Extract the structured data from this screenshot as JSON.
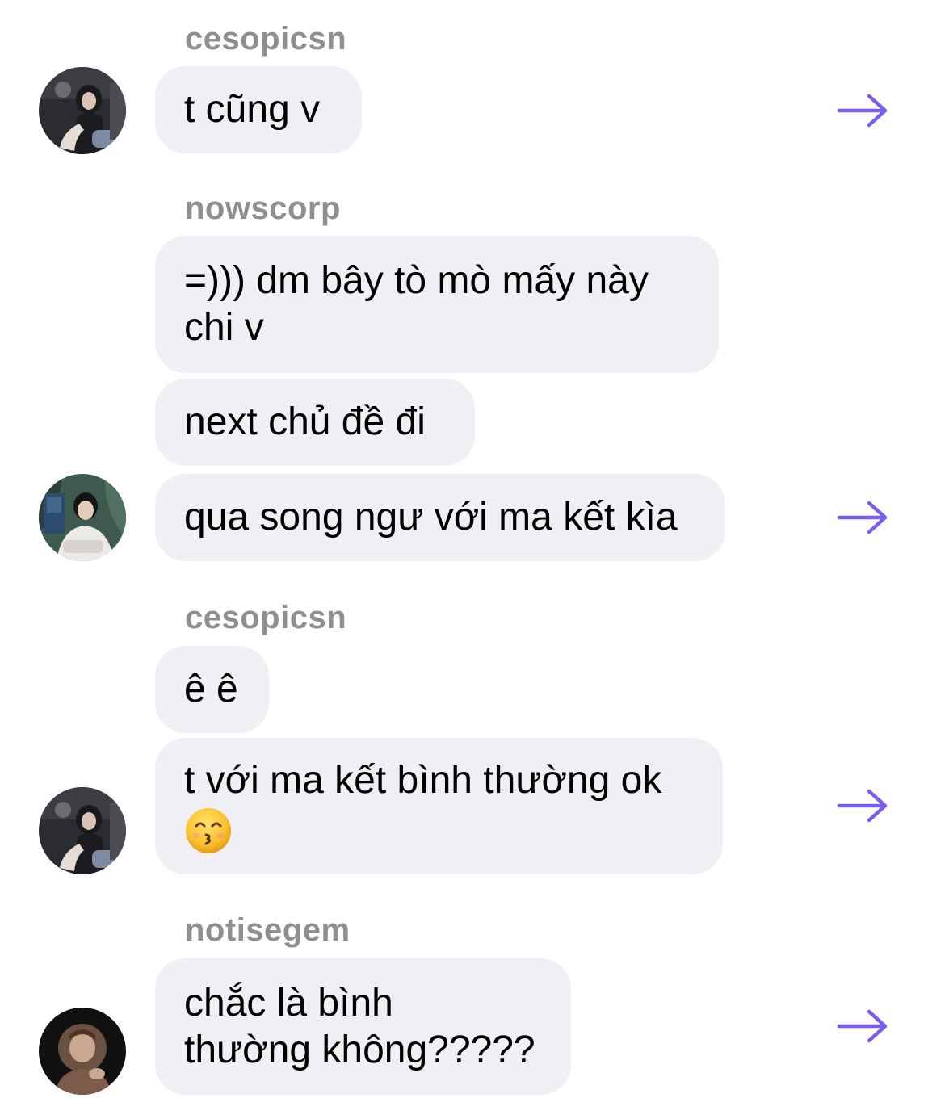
{
  "messages": [
    {
      "username": "cesopicsn",
      "bubbles": [
        [
          "t cũng v"
        ]
      ]
    },
    {
      "username": "nowscorp",
      "bubbles": [
        [
          "=))) dm bây tò mò mấy này",
          "chi v"
        ],
        [
          "next chủ đề đi"
        ],
        [
          "qua song ngư với ma kết kìa"
        ]
      ]
    },
    {
      "username": "cesopicsn",
      "bubbles": [
        [
          "ê ê"
        ],
        [
          "t với ma kết bình thường ok"
        ]
      ]
    },
    {
      "username": "notisegem",
      "bubbles": [
        [
          "chắc là bình",
          "thường không?????"
        ]
      ]
    }
  ],
  "emoji": {
    "name": "kissing-smiling-eyes-emoji",
    "char": "😙"
  },
  "icons": {
    "forward": "arrow-right-icon",
    "avatar_group_1": "avatar-cesopicsn",
    "avatar_group_2": "avatar-nowscorp",
    "avatar_group_3": "avatar-cesopicsn",
    "avatar_group_4": "avatar-notisegem"
  },
  "colors": {
    "bubble_bg": "#efeff4",
    "username": "#8e8e93",
    "arrow": "#7b5cf0",
    "text": "#000000"
  }
}
